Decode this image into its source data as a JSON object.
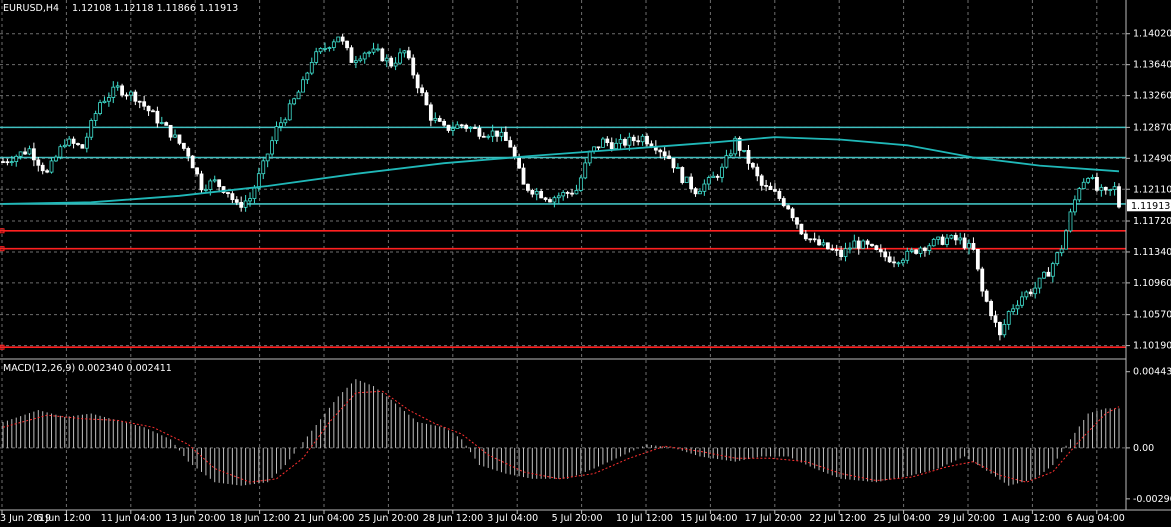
{
  "header": {
    "symbol": "EURUSD,H4",
    "ohlc": "1.12108 1.12118 1.11866 1.11913"
  },
  "macd": {
    "label": "MACD(12,26,9) 0.002340 0.002411",
    "axis": [
      "0.004435",
      "0.00",
      "-0.002968"
    ]
  },
  "price_axis": [
    "1.14020",
    "1.13640",
    "1.13260",
    "1.12870",
    "1.12490",
    "1.12110",
    "1.11720",
    "1.11340",
    "1.10960",
    "1.10570",
    "1.10190"
  ],
  "current_price": "1.11913",
  "time_axis": [
    "3 Jun 2019",
    "6 Jun 12:00",
    "11 Jun 04:00",
    "13 Jun 20:00",
    "18 Jun 12:00",
    "21 Jun 04:00",
    "25 Jun 20:00",
    "28 Jun 12:00",
    "3 Jul 04:00",
    "5 Jul 20:00",
    "10 Jul 12:00",
    "15 Jul 04:00",
    "17 Jul 20:00",
    "22 Jul 12:00",
    "25 Jul 04:00",
    "29 Jul 20:00",
    "1 Aug 12:00",
    "6 Aug 04:00"
  ],
  "colors": {
    "background": "#000000",
    "grid": "#6e6e6e",
    "bull_candle": "#40e0d0",
    "bear_candle": "#ffffff",
    "level_line": "#40c0c0",
    "support_line": "#ff2020",
    "moving_average": "#20b8b8",
    "macd_histogram": "#c0c0c0",
    "macd_signal": "#ff3030"
  },
  "chart_data": {
    "type": "candlestick",
    "symbol": "EURUSD",
    "timeframe": "H4",
    "price_range": [
      1.1005,
      1.1425
    ],
    "horizontal_levels": [
      {
        "price": 1.1287,
        "color": "cyan"
      },
      {
        "price": 1.125,
        "color": "cyan"
      },
      {
        "price": 1.1193,
        "color": "cyan"
      },
      {
        "price": 1.116,
        "color": "red"
      },
      {
        "price": 1.1138,
        "color": "red"
      },
      {
        "price": 1.1017,
        "color": "red"
      }
    ],
    "close_path": [
      [
        0,
        1.1245
      ],
      [
        6,
        1.126
      ],
      [
        10,
        1.123
      ],
      [
        14,
        1.127
      ],
      [
        18,
        1.1262
      ],
      [
        22,
        1.1318
      ],
      [
        26,
        1.1335
      ],
      [
        30,
        1.1325
      ],
      [
        34,
        1.1302
      ],
      [
        38,
        1.128
      ],
      [
        42,
        1.1255
      ],
      [
        45,
        1.1215
      ],
      [
        48,
        1.122
      ],
      [
        51,
        1.1208
      ],
      [
        53,
        1.119
      ],
      [
        56,
        1.12
      ],
      [
        59,
        1.124
      ],
      [
        62,
        1.1285
      ],
      [
        65,
        1.131
      ],
      [
        68,
        1.134
      ],
      [
        70,
        1.137
      ],
      [
        73,
        1.1385
      ],
      [
        76,
        1.14
      ],
      [
        79,
        1.137
      ],
      [
        82,
        1.138
      ],
      [
        85,
        1.1378
      ],
      [
        88,
        1.1365
      ],
      [
        91,
        1.138
      ],
      [
        94,
        1.134
      ],
      [
        97,
        1.13
      ],
      [
        100,
        1.1285
      ],
      [
        104,
        1.129
      ],
      [
        108,
        1.1282
      ],
      [
        112,
        1.128
      ],
      [
        115,
        1.1265
      ],
      [
        118,
        1.1215
      ],
      [
        121,
        1.1208
      ],
      [
        124,
        1.12
      ],
      [
        127,
        1.1205
      ],
      [
        130,
        1.121
      ],
      [
        133,
        1.1255
      ],
      [
        136,
        1.127
      ],
      [
        139,
        1.1265
      ],
      [
        142,
        1.127
      ],
      [
        145,
        1.1275
      ],
      [
        148,
        1.1265
      ],
      [
        151,
        1.125
      ],
      [
        154,
        1.1225
      ],
      [
        157,
        1.121
      ],
      [
        160,
        1.122
      ],
      [
        163,
        1.1235
      ],
      [
        166,
        1.127
      ],
      [
        169,
        1.1245
      ],
      [
        172,
        1.1215
      ],
      [
        175,
        1.1205
      ],
      [
        178,
        1.119
      ],
      [
        181,
        1.116
      ],
      [
        184,
        1.1145
      ],
      [
        187,
        1.1138
      ],
      [
        190,
        1.113
      ],
      [
        193,
        1.1145
      ],
      [
        196,
        1.114
      ],
      [
        199,
        1.113
      ],
      [
        202,
        1.1125
      ],
      [
        205,
        1.113
      ],
      [
        208,
        1.114
      ],
      [
        211,
        1.1145
      ],
      [
        214,
        1.115
      ],
      [
        217,
        1.1148
      ],
      [
        220,
        1.1135
      ],
      [
        222,
        1.1085
      ],
      [
        224,
        1.106
      ],
      [
        226,
        1.103
      ],
      [
        228,
        1.106
      ],
      [
        231,
        1.108
      ],
      [
        234,
        1.109
      ],
      [
        237,
        1.111
      ],
      [
        240,
        1.114
      ],
      [
        242,
        1.118
      ],
      [
        244,
        1.1215
      ],
      [
        246,
        1.123
      ],
      [
        248,
        1.121
      ],
      [
        250,
        1.1205
      ],
      [
        252,
        1.1212
      ],
      [
        253,
        1.1191
      ]
    ],
    "moving_average_path": [
      [
        0,
        1.1193
      ],
      [
        20,
        1.1195
      ],
      [
        40,
        1.1203
      ],
      [
        60,
        1.1215
      ],
      [
        80,
        1.123
      ],
      [
        100,
        1.1243
      ],
      [
        120,
        1.1252
      ],
      [
        140,
        1.126
      ],
      [
        160,
        1.1268
      ],
      [
        175,
        1.1275
      ],
      [
        190,
        1.1272
      ],
      [
        205,
        1.1265
      ],
      [
        220,
        1.125
      ],
      [
        235,
        1.124
      ],
      [
        253,
        1.1233
      ]
    ],
    "macd_range": [
      -0.0035,
      0.005
    ],
    "macd_histogram": [
      [
        0,
        0.0015
      ],
      [
        8,
        0.0022
      ],
      [
        14,
        0.0018
      ],
      [
        20,
        0.002
      ],
      [
        26,
        0.0016
      ],
      [
        32,
        0.0012
      ],
      [
        38,
        0.0005
      ],
      [
        42,
        -0.0008
      ],
      [
        48,
        -0.002
      ],
      [
        54,
        -0.0022
      ],
      [
        60,
        -0.002
      ],
      [
        64,
        -0.001
      ],
      [
        70,
        0.001
      ],
      [
        76,
        0.003
      ],
      [
        80,
        0.004
      ],
      [
        84,
        0.0036
      ],
      [
        88,
        0.0028
      ],
      [
        94,
        0.0015
      ],
      [
        100,
        0.0012
      ],
      [
        104,
        0.0005
      ],
      [
        108,
        -0.001
      ],
      [
        114,
        -0.0015
      ],
      [
        120,
        -0.0018
      ],
      [
        128,
        -0.0018
      ],
      [
        134,
        -0.0012
      ],
      [
        140,
        -0.0005
      ],
      [
        146,
        0.0002
      ],
      [
        152,
        0.0
      ],
      [
        158,
        -0.0005
      ],
      [
        166,
        -0.0008
      ],
      [
        172,
        -0.0005
      ],
      [
        178,
        -0.0005
      ],
      [
        184,
        -0.0012
      ],
      [
        190,
        -0.0018
      ],
      [
        198,
        -0.002
      ],
      [
        206,
        -0.0016
      ],
      [
        212,
        -0.0012
      ],
      [
        218,
        -0.0005
      ],
      [
        224,
        -0.0015
      ],
      [
        228,
        -0.0022
      ],
      [
        234,
        -0.0018
      ],
      [
        238,
        -0.001
      ],
      [
        242,
        0.0005
      ],
      [
        246,
        0.002
      ],
      [
        250,
        0.0023
      ],
      [
        253,
        0.0023
      ]
    ],
    "macd_signal": [
      [
        0,
        0.0012
      ],
      [
        10,
        0.0019
      ],
      [
        18,
        0.0017
      ],
      [
        26,
        0.0016
      ],
      [
        34,
        0.0012
      ],
      [
        42,
        0.0002
      ],
      [
        48,
        -0.0012
      ],
      [
        56,
        -0.002
      ],
      [
        62,
        -0.0018
      ],
      [
        68,
        -0.0006
      ],
      [
        74,
        0.0015
      ],
      [
        80,
        0.0032
      ],
      [
        86,
        0.0033
      ],
      [
        92,
        0.0022
      ],
      [
        98,
        0.0014
      ],
      [
        104,
        0.0008
      ],
      [
        110,
        -0.0004
      ],
      [
        118,
        -0.0014
      ],
      [
        126,
        -0.0018
      ],
      [
        134,
        -0.0015
      ],
      [
        142,
        -0.0006
      ],
      [
        150,
        0.0001
      ],
      [
        158,
        -0.0002
      ],
      [
        166,
        -0.0006
      ],
      [
        174,
        -0.0006
      ],
      [
        182,
        -0.0008
      ],
      [
        190,
        -0.0015
      ],
      [
        198,
        -0.0019
      ],
      [
        206,
        -0.0017
      ],
      [
        214,
        -0.0011
      ],
      [
        220,
        -0.0008
      ],
      [
        226,
        -0.0016
      ],
      [
        232,
        -0.002
      ],
      [
        238,
        -0.0014
      ],
      [
        244,
        0.0004
      ],
      [
        250,
        0.002
      ],
      [
        253,
        0.0024
      ]
    ]
  }
}
